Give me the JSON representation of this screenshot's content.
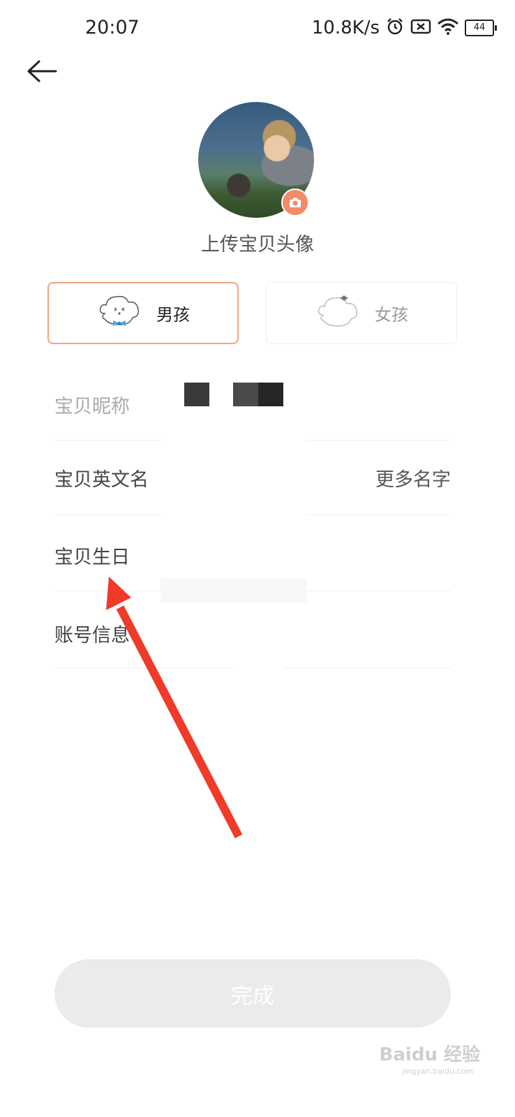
{
  "status_bar": {
    "time": "20:07",
    "net_speed": "10.8K/s",
    "battery": "44",
    "icons": [
      "alarm-icon",
      "no-sim-icon",
      "wifi-icon",
      "battery-icon"
    ]
  },
  "header": {
    "back_icon": "arrow-left-icon"
  },
  "avatar": {
    "upload_label": "上传宝贝头像",
    "badge_icon": "camera-icon",
    "badge_color": "#f48a66"
  },
  "gender": {
    "boy_label": "男孩",
    "girl_label": "女孩",
    "selected": "boy",
    "selected_border_color": "#f0a482"
  },
  "form": {
    "nickname_label": "宝贝昵称",
    "english_name_label": "宝贝英文名",
    "more_names_label": "更多名字",
    "birthday_label": "宝贝生日",
    "account_label": "账号信息"
  },
  "done_button": {
    "label": "完成"
  },
  "watermark": {
    "brand": "Baidu 经验",
    "url": "jingyan.baidu.com"
  },
  "annotation": {
    "arrow_color": "#f03a2a"
  }
}
